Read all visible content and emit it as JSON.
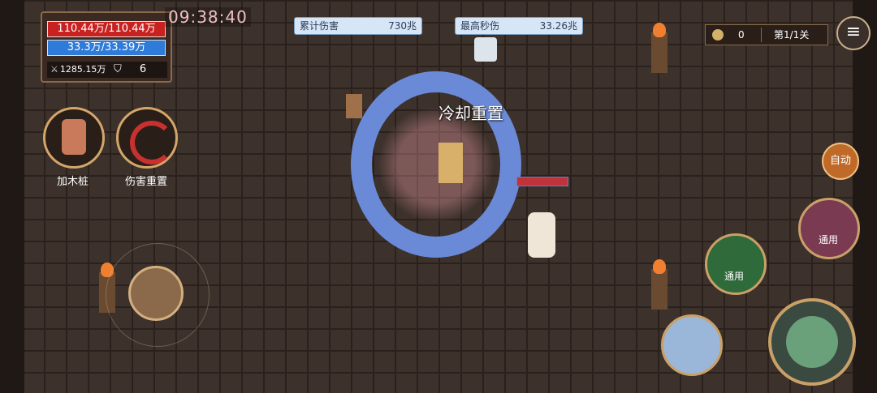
{
  "player": {
    "hp": "110.44万/110.44万",
    "mp": "33.3万/33.39万",
    "attack": "1285.15万",
    "defense": "6"
  },
  "timer": "09:38:40",
  "damage_stats": {
    "total_label": "累计伤害",
    "total_value": "730兆",
    "peak_label": "最高秒伤",
    "peak_value": "33.26兆"
  },
  "currency": {
    "gold": "0",
    "stage": "第1/1关"
  },
  "buttons": {
    "add_dummy": "加木桩",
    "reset_damage": "伤害重置",
    "auto": "自动"
  },
  "skills": {
    "ring_label": "通用",
    "scroll_label": "通用"
  },
  "effect_text": "冷却重置",
  "colors": {
    "hp": "#c8211f",
    "mp": "#2f7bd9",
    "accent": "#d4a66a"
  }
}
